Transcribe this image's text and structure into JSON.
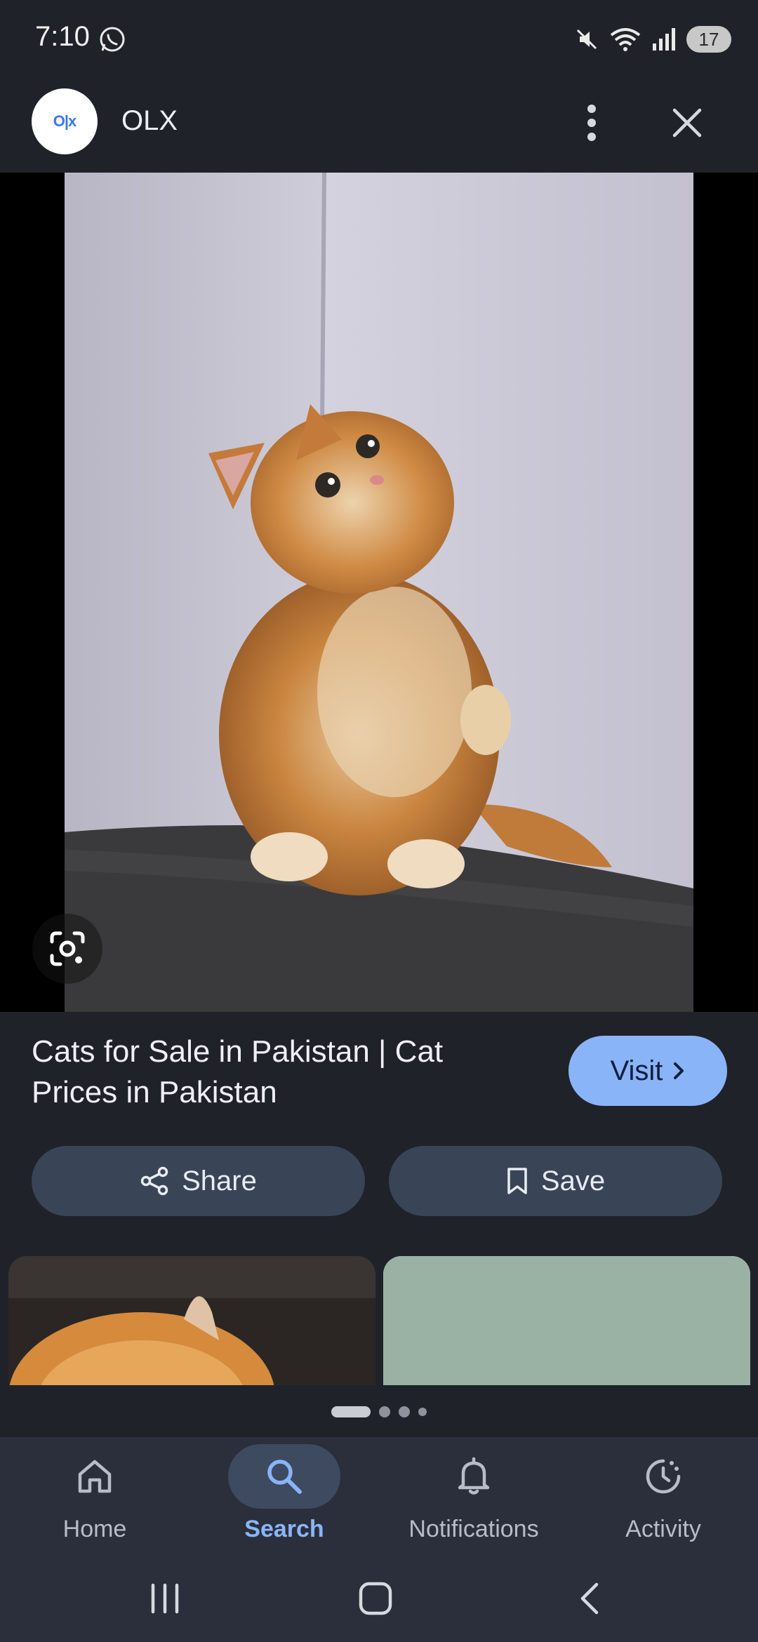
{
  "status_bar": {
    "time": "7:10",
    "battery": "17",
    "icons": [
      "whatsapp-icon",
      "mute-icon",
      "wifi-icon",
      "signal-icon",
      "battery-icon"
    ]
  },
  "header": {
    "logo_text": "O|x",
    "site_name": "OLX",
    "menu_icon": "more-vert-icon",
    "close_icon": "close-icon"
  },
  "image": {
    "lens_icon": "lens-icon"
  },
  "result": {
    "title": "Cats for Sale in Pakistan | Cat Prices in Pakistan",
    "visit_label": "Visit"
  },
  "actions": {
    "share_label": "Share",
    "save_label": "Save"
  },
  "pager": {
    "count": 4,
    "active_index": 0
  },
  "bottom_nav": {
    "items": [
      {
        "label": "Home",
        "icon": "home-icon"
      },
      {
        "label": "Search",
        "icon": "search-icon",
        "active": true
      },
      {
        "label": "Notifications",
        "icon": "bell-icon"
      },
      {
        "label": "Activity",
        "icon": "activity-icon"
      }
    ]
  },
  "colors": {
    "background": "#1f2229",
    "accent": "#8ab4f8",
    "button_bg": "#394457",
    "nav_bg": "#2a2f3b"
  }
}
